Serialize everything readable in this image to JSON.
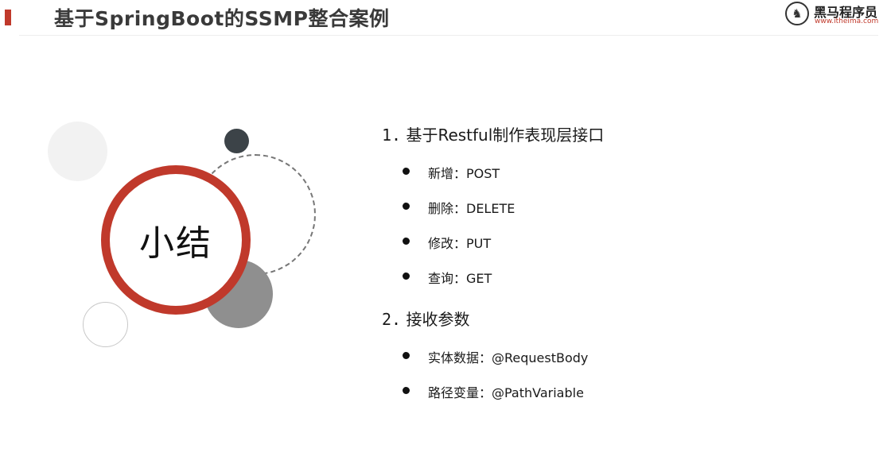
{
  "header": {
    "title": "基于SpringBoot的SSMP整合案例",
    "logo": {
      "icon": "horse-logo-icon",
      "name": "黑马程序员",
      "url": "www.itheima.com"
    }
  },
  "graphic": {
    "center_label": "小结"
  },
  "sections": [
    {
      "number": "1.",
      "title": "基于Restful制作表现层接口",
      "items": [
        "新增：POST",
        "删除：DELETE",
        "修改：PUT",
        "查询：GET"
      ]
    },
    {
      "number": "2.",
      "title": "接收参数",
      "items": [
        "实体数据：@RequestBody",
        "路径变量：@PathVariable"
      ]
    }
  ],
  "colors": {
    "accent": "#c0392b",
    "dark_circle": "#3c4348",
    "gray_circle": "#8f8f8f"
  }
}
